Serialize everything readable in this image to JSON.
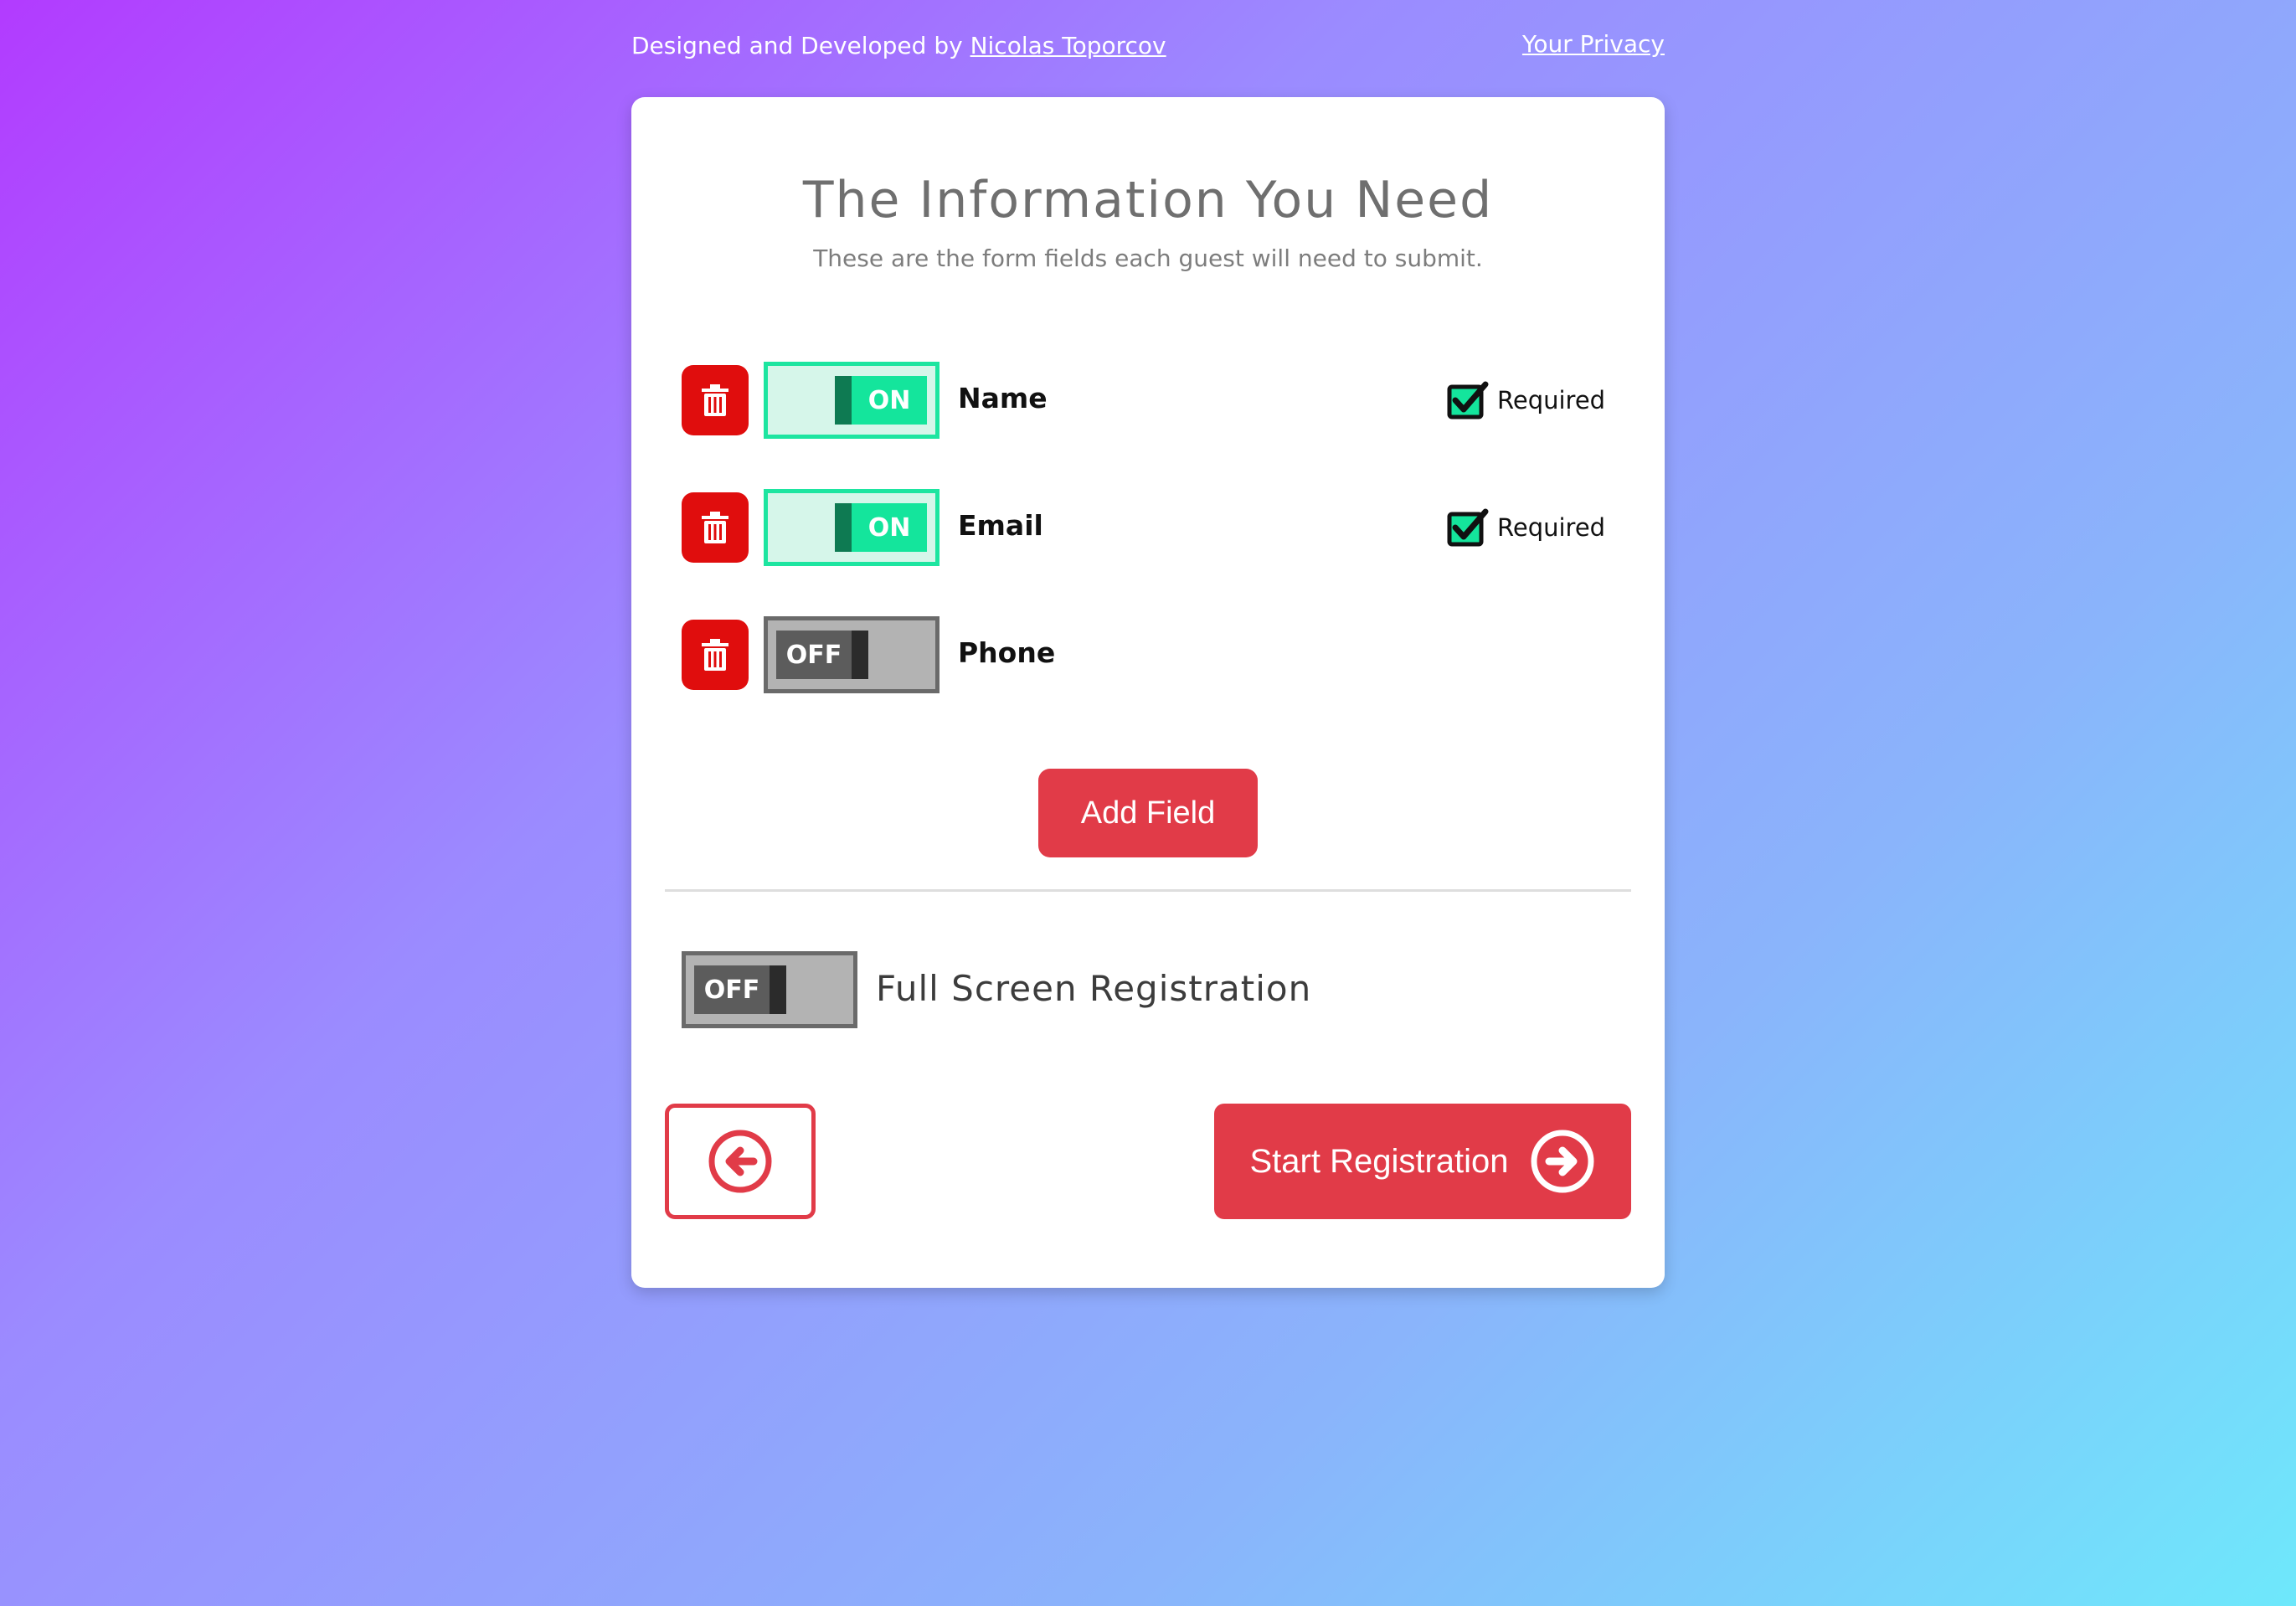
{
  "header": {
    "credit_prefix": "Designed and Developed by",
    "credit_author": "Nicolas Toporcov",
    "privacy_link": "Your Privacy"
  },
  "card": {
    "title": "The Information You Need",
    "subtitle": "These are the form fields each guest will need to submit."
  },
  "fields": [
    {
      "label": "Name",
      "toggle": "ON",
      "required_label": "Required",
      "required": true
    },
    {
      "label": "Email",
      "toggle": "ON",
      "required_label": "Required",
      "required": true
    },
    {
      "label": "Phone",
      "toggle": "OFF"
    }
  ],
  "add_field_label": "Add Field",
  "full_screen": {
    "label": "Full Screen Registration",
    "toggle": "OFF"
  },
  "start_label": "Start Registration",
  "colors": {
    "accent": "#e13b48",
    "trash": "#e00d0d",
    "on": "#14e59c",
    "off": "#5c5c5c"
  },
  "icons": {
    "trash": "trash-icon",
    "back": "arrow-left-circle-icon",
    "start": "arrow-right-circle-icon",
    "check": "checkbox-checked-icon"
  }
}
